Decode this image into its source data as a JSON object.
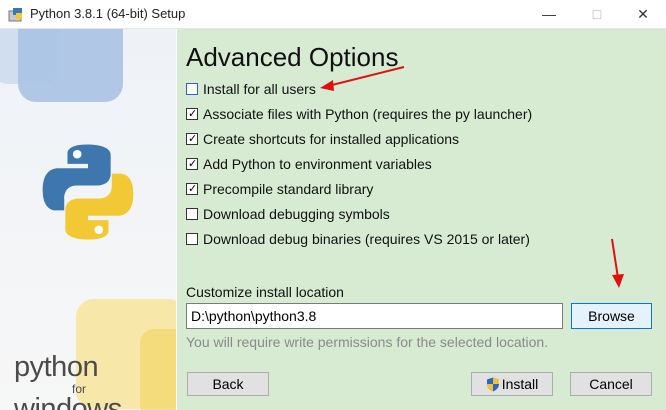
{
  "window": {
    "title": "Python 3.8.1 (64-bit) Setup",
    "icons": {
      "app": "python-setup-icon",
      "minimize": "minimize-icon",
      "maximize": "maximize-icon",
      "close": "close-icon"
    }
  },
  "banner": {
    "brand_line1": "python",
    "brand_line2": "for",
    "brand_line3": "windows",
    "logo": "python-logo-icon"
  },
  "panel": {
    "heading": "Advanced Options",
    "options": [
      {
        "label": "Install for all users",
        "checked": false
      },
      {
        "label": "Associate files with Python (requires the py launcher)",
        "checked": true
      },
      {
        "label": "Create shortcuts for installed applications",
        "checked": true
      },
      {
        "label": "Add Python to environment variables",
        "checked": true
      },
      {
        "label": "Precompile standard library",
        "checked": true
      },
      {
        "label": "Download debugging symbols",
        "checked": false
      },
      {
        "label": "Download debug binaries (requires VS 2015 or later)",
        "checked": false
      }
    ],
    "location_label": "Customize install location",
    "location_value": "D:\\python\\python3.8",
    "browse_label": "Browse",
    "permission_note": "You will require write permissions for the selected location."
  },
  "footer": {
    "back_label": "Back",
    "install_label": "Install",
    "cancel_label": "Cancel"
  },
  "colors": {
    "panel_bg": "#d7ebd3",
    "annotation_arrow": "#e01010",
    "focus_border": "#0078d7"
  }
}
